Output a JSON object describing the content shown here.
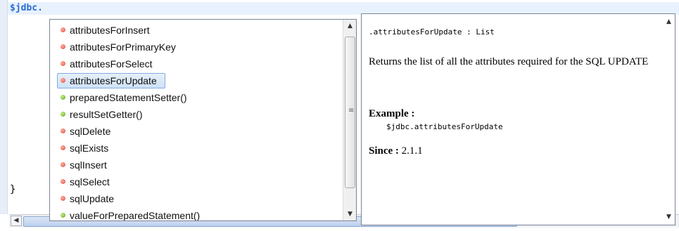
{
  "editor": {
    "code_line": "$jdbc.",
    "closing_brace": "}"
  },
  "completion": {
    "items": [
      {
        "label": "attributesForInsert",
        "kind": "field",
        "icon": "red-dot-icon",
        "selected": false
      },
      {
        "label": "attributesForPrimaryKey",
        "kind": "field",
        "icon": "red-dot-icon",
        "selected": false
      },
      {
        "label": "attributesForSelect",
        "kind": "field",
        "icon": "red-dot-icon",
        "selected": false
      },
      {
        "label": "attributesForUpdate",
        "kind": "field",
        "icon": "red-dot-icon",
        "selected": true
      },
      {
        "label": "preparedStatementSetter()",
        "kind": "method",
        "icon": "green-dot-icon",
        "selected": false
      },
      {
        "label": "resultSetGetter()",
        "kind": "method",
        "icon": "green-dot-icon",
        "selected": false
      },
      {
        "label": "sqlDelete",
        "kind": "field",
        "icon": "red-dot-icon",
        "selected": false
      },
      {
        "label": "sqlExists",
        "kind": "field",
        "icon": "red-dot-icon",
        "selected": false
      },
      {
        "label": "sqlInsert",
        "kind": "field",
        "icon": "red-dot-icon",
        "selected": false
      },
      {
        "label": "sqlSelect",
        "kind": "field",
        "icon": "red-dot-icon",
        "selected": false
      },
      {
        "label": "sqlUpdate",
        "kind": "field",
        "icon": "red-dot-icon",
        "selected": false
      },
      {
        "label": "valueForPreparedStatement()",
        "kind": "method",
        "icon": "green-dot-icon",
        "selected": false
      }
    ]
  },
  "doc": {
    "signature": ".attributesForUpdate : List",
    "description": "Returns the list of all the attributes required for the SQL UPDATE",
    "example_label": "Example :",
    "example_code": "$jdbc.attributesForUpdate",
    "since_label": "Since :",
    "since_value": " 2.1.1"
  },
  "colors": {
    "field_dot": "#e0493a",
    "method_dot": "#5aa218",
    "keyword_blue": "#2a6bd1",
    "selection_bg": "#cfe2f7"
  }
}
